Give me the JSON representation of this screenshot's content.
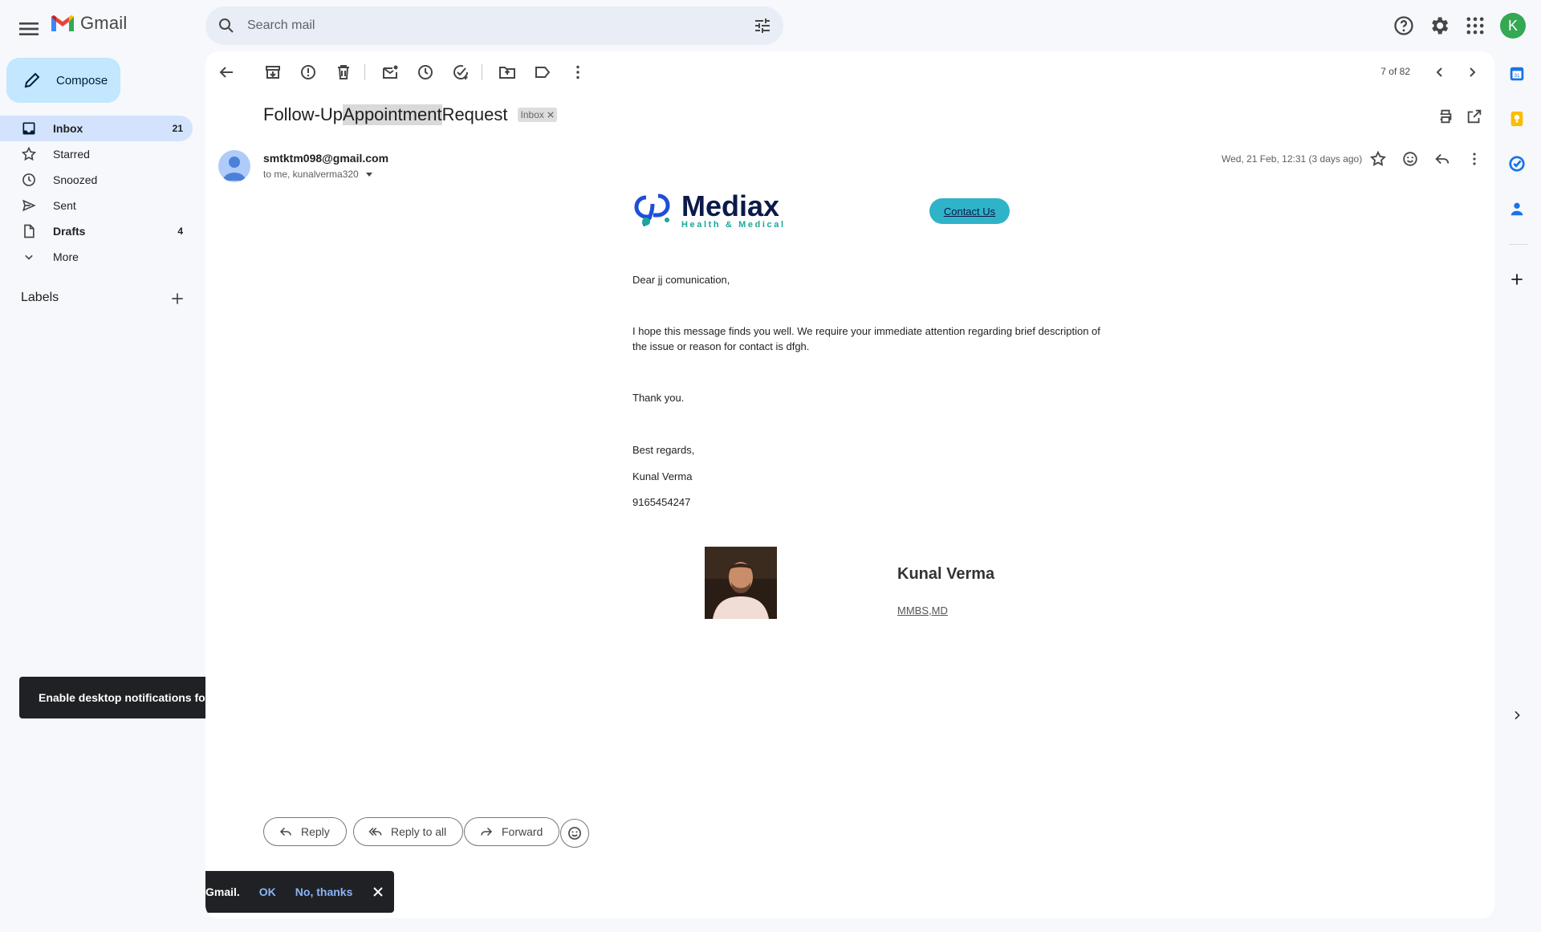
{
  "app": {
    "name": "Gmail",
    "avatar_letter": "K",
    "brand_colors": {
      "red": "#ea4335",
      "blue": "#4285f4",
      "green": "#34a853",
      "yellow": "#fbbc04"
    }
  },
  "search": {
    "placeholder": "Search mail"
  },
  "compose": {
    "label": "Compose"
  },
  "nav": [
    {
      "label": "Inbox",
      "count": "21",
      "icon": "inbox-icon",
      "active": true,
      "bold": true
    },
    {
      "label": "Starred",
      "count": "",
      "icon": "star-icon"
    },
    {
      "label": "Snoozed",
      "count": "",
      "icon": "clock-icon"
    },
    {
      "label": "Sent",
      "count": "",
      "icon": "send-icon"
    },
    {
      "label": "Drafts",
      "count": "4",
      "icon": "draft-icon",
      "bold": true
    },
    {
      "label": "More",
      "count": "",
      "icon": "chevron-down-icon"
    }
  ],
  "labels": {
    "title": "Labels"
  },
  "toolbar": {
    "pager": "7 of 82"
  },
  "message": {
    "subject_pre": "Follow-Up ",
    "subject_hl": "Appointment",
    "subject_post": " Request",
    "badge": "Inbox",
    "sender": "smtktm098@gmail.com",
    "recipients": "to me, kunalverma320",
    "date": "Wed, 21 Feb, 12:31 (3 days ago)"
  },
  "email": {
    "brand_name": "Mediax",
    "brand_tagline": "Health & Medical",
    "contact_label": "Contact Us",
    "greeting": "Dear jj comunication,",
    "paragraph": "I hope this message finds you well. We require your immediate attention regarding brief description of the issue or reason for contact is dfgh.",
    "thanks": "Thank you.",
    "closing": "Best regards,",
    "sign_name": "Kunal Verma",
    "sign_phone": "9165454247",
    "card_name": "Kunal Verma",
    "card_quals": "MMBS,MD"
  },
  "actions": {
    "reply": "Reply",
    "reply_all": "Reply to all",
    "forward": "Forward"
  },
  "notifications": {
    "desktop_prompt": "Enable desktop notifications for Gmail.",
    "desktop_prompt_visible_left": "Enable desktop notifications for G",
    "desktop_prompt_visible_right": "Gmail.",
    "ok": "OK",
    "no_thanks": "No, thanks"
  }
}
